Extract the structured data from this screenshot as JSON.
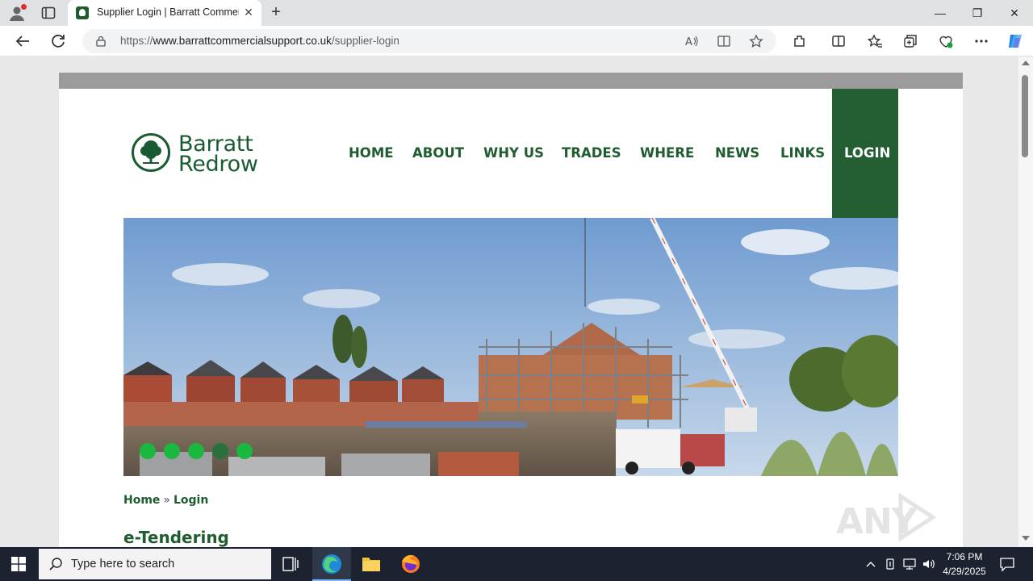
{
  "browser": {
    "tab_title": "Supplier Login | Barratt Commercial Support",
    "url_prefix": "https://",
    "url_domain": "www.barrattcommercialsupport.co.uk",
    "url_path": "/supplier-login",
    "close_tab": "✕",
    "new_tab": "+",
    "minimize": "—",
    "restore": "❐",
    "close_window": "✕"
  },
  "site": {
    "logo_line1": "Barratt",
    "logo_line2": "Redrow",
    "nav": [
      "HOME",
      "ABOUT",
      "WHY US",
      "TRADES",
      "WHERE",
      "NEWS",
      "LINKS"
    ],
    "nav_login": "LOGIN",
    "breadcrumb_home": "Home",
    "breadcrumb_sep": "»",
    "breadcrumb_current": "Login",
    "heading": "e-Tendering",
    "slides_count": 5,
    "active_slide": 4,
    "brand_color": "#235f33"
  },
  "watermark": {
    "text": "ANY  RUN"
  },
  "taskbar": {
    "search_placeholder": "Type here to search",
    "time": "7:06 PM",
    "date": "4/29/2025"
  }
}
